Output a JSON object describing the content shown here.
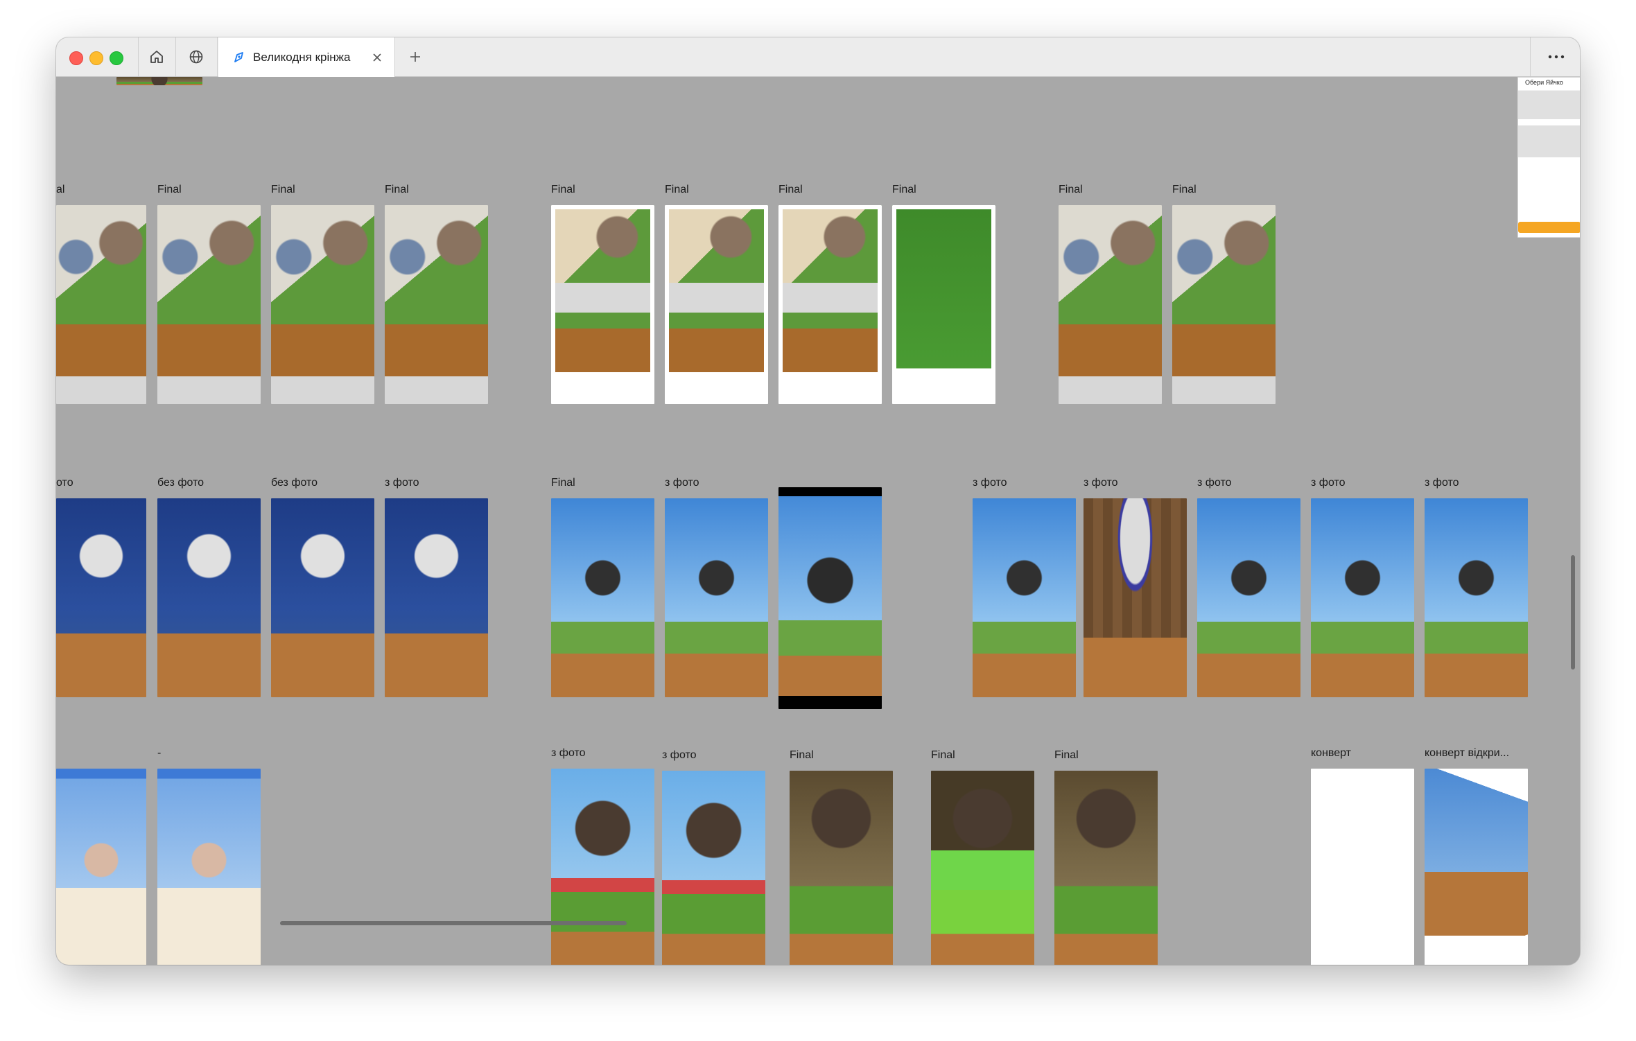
{
  "window": {
    "tab_title": "Великодня крінжа",
    "icons": {
      "home": "home-icon",
      "globe": "globe-icon",
      "tab": "figma-pen-icon",
      "close": "close-icon",
      "new_tab": "plus-icon",
      "more": "more-dots-icon"
    }
  },
  "canvas": {
    "side_panel_title": "Обери Яйчко",
    "labels": {
      "final": "Final",
      "no_photo": "без фото",
      "with_photo": "з фото",
      "with_photo_alt": "з фото",
      "dash": "-",
      "envelope": "конверт",
      "envelope_open": "конверт відкри...",
      "partial_al": "al",
      "partial_oto": "ото"
    }
  }
}
